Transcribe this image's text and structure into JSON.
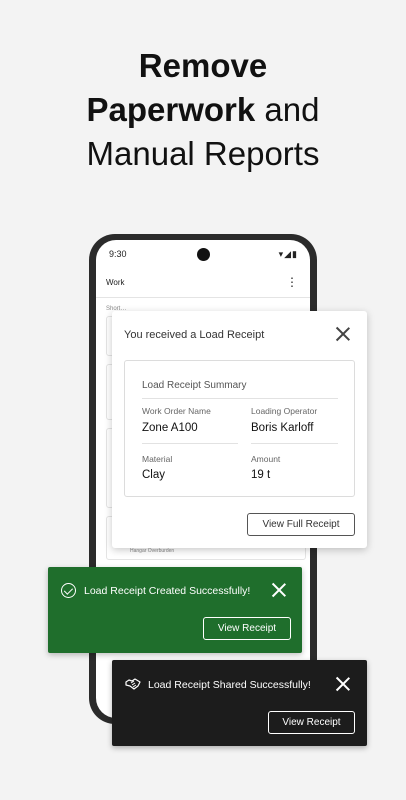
{
  "headline": {
    "line1": "Remove",
    "line2_bold": "Paperwork",
    "line2_rest": " and",
    "line3": "Manual Reports"
  },
  "phone": {
    "time": "9:30",
    "status_icons": "▾◢▮",
    "app_title": "Work",
    "kebab": "⋮",
    "short_label": "Short…",
    "ghost_card_text": "Hangar Overburden"
  },
  "receipt_dialog": {
    "title": "You received a Load Receipt",
    "summary_title": "Load Receipt Summary",
    "fields": {
      "work_order_label": "Work Order Name",
      "work_order_value": "Zone A100",
      "operator_label": "Loading Operator",
      "operator_value": "Boris Karloff",
      "material_label": "Material",
      "material_value": "Clay",
      "amount_label": "Amount",
      "amount_value": "19 t"
    },
    "button": "View Full Receipt"
  },
  "toast_created": {
    "message": "Load Receipt Created Successfully!",
    "button": "View Receipt",
    "color": "#1f6e2c"
  },
  "toast_shared": {
    "message": "Load Receipt Shared Successfully!",
    "button": "View Receipt",
    "color": "#1c1c1c"
  }
}
